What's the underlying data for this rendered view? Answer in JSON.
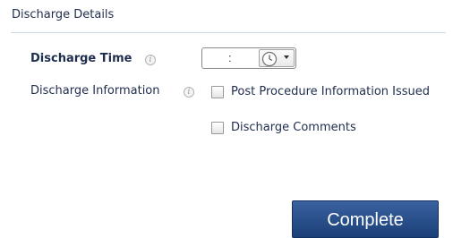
{
  "section": {
    "title": "Discharge Details"
  },
  "discharge_time": {
    "label": "Discharge Time",
    "separator": ":"
  },
  "discharge_information": {
    "label": "Discharge Information",
    "options": [
      {
        "label": "Post Procedure Information Issued",
        "checked": false
      },
      {
        "label": "Discharge Comments",
        "checked": false
      }
    ]
  },
  "actions": {
    "complete_label": "Complete"
  },
  "colors": {
    "text": "#1f2d4d",
    "divider": "#c7dde6",
    "button_bg": "#1b3f78"
  },
  "icons": [
    "info-icon",
    "clock-icon",
    "chevron-down-icon"
  ]
}
